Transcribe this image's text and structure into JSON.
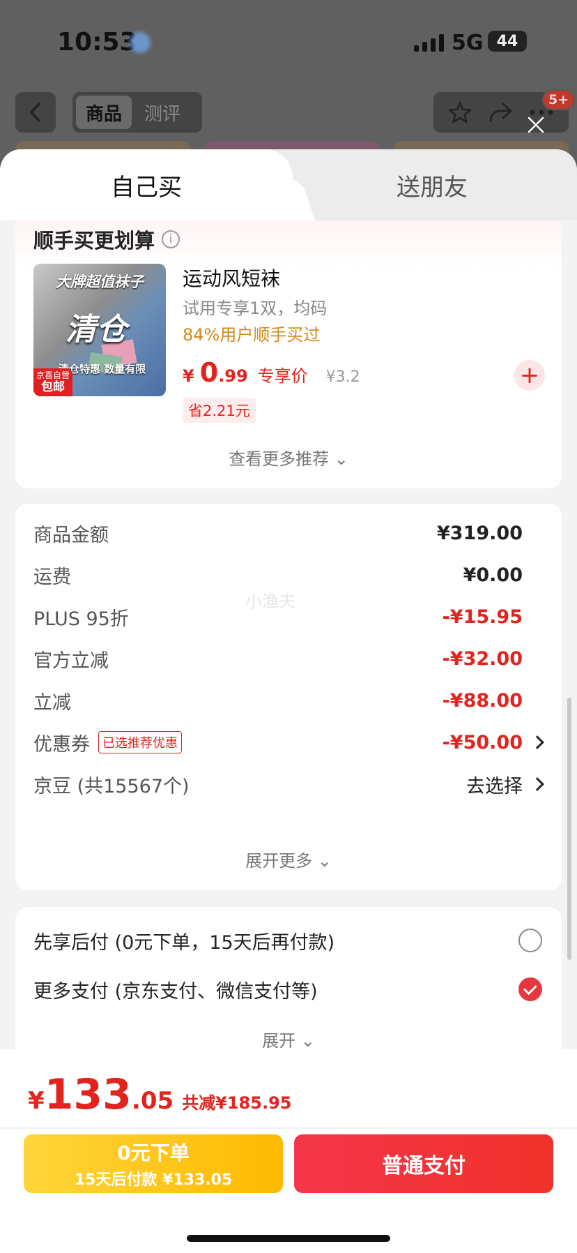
{
  "status_bar": {
    "time": "10:53",
    "network": "5G",
    "battery": "44"
  },
  "nav": {
    "tabs": [
      "商品",
      "测评"
    ],
    "cart_badge": "5+"
  },
  "sheet": {
    "tab_self": "自己买",
    "tab_gift": "送朋友"
  },
  "recommend": {
    "title": "顺手买更划算",
    "info_icon": "i",
    "image_text": {
      "banner": "大牌超值袜子",
      "big": "清仓",
      "sub": "清仓特惠 数量有限",
      "logo_top": "京喜自营",
      "logo_bottom": "包邮"
    },
    "product": {
      "name": "运动风短袜",
      "spec": "试用专享1双，均码",
      "social": "84%用户顺手买过",
      "price_currency": "¥",
      "price_int": "0",
      "price_dec": ".99",
      "price_tag": "专享价",
      "original_price": "¥3.2",
      "save": "省2.21元",
      "add_symbol": "+"
    },
    "more_label": "查看更多推荐 ⌄"
  },
  "summary": {
    "watermark": "小渔夫",
    "rows": [
      {
        "label": "商品金额",
        "value": "¥319.00"
      },
      {
        "label": "运费",
        "value": "¥0.00"
      },
      {
        "label": "PLUS 95折",
        "value": "-¥15.95"
      },
      {
        "label": "官方立减",
        "value": "-¥32.00"
      },
      {
        "label": "立减",
        "value": "-¥88.00"
      },
      {
        "label": "优惠券",
        "chip": "已选推荐优惠",
        "value": "-¥50.00"
      },
      {
        "label": "京豆 (共15567个)",
        "value": "去选择"
      }
    ],
    "expand_label": "展开更多 ⌄"
  },
  "payment": {
    "options": [
      {
        "label": "先享后付 (0元下单，15天后再付款)",
        "checked": false
      },
      {
        "label": "更多支付 (京东支付、微信支付等)",
        "checked": true
      }
    ],
    "expand_label": "展开 ⌄"
  },
  "bottom": {
    "total_currency": "¥",
    "total_int": "133",
    "total_dec": ".05",
    "total_save": "共减¥185.95",
    "btn_later_line1": "0元下单",
    "btn_later_line2": "15天后付款 ¥133.05",
    "btn_pay": "普通支付"
  },
  "colors": {
    "accent_red": "#e3231d",
    "button_yellow": "#ffc31a",
    "button_red": "#f23545"
  }
}
